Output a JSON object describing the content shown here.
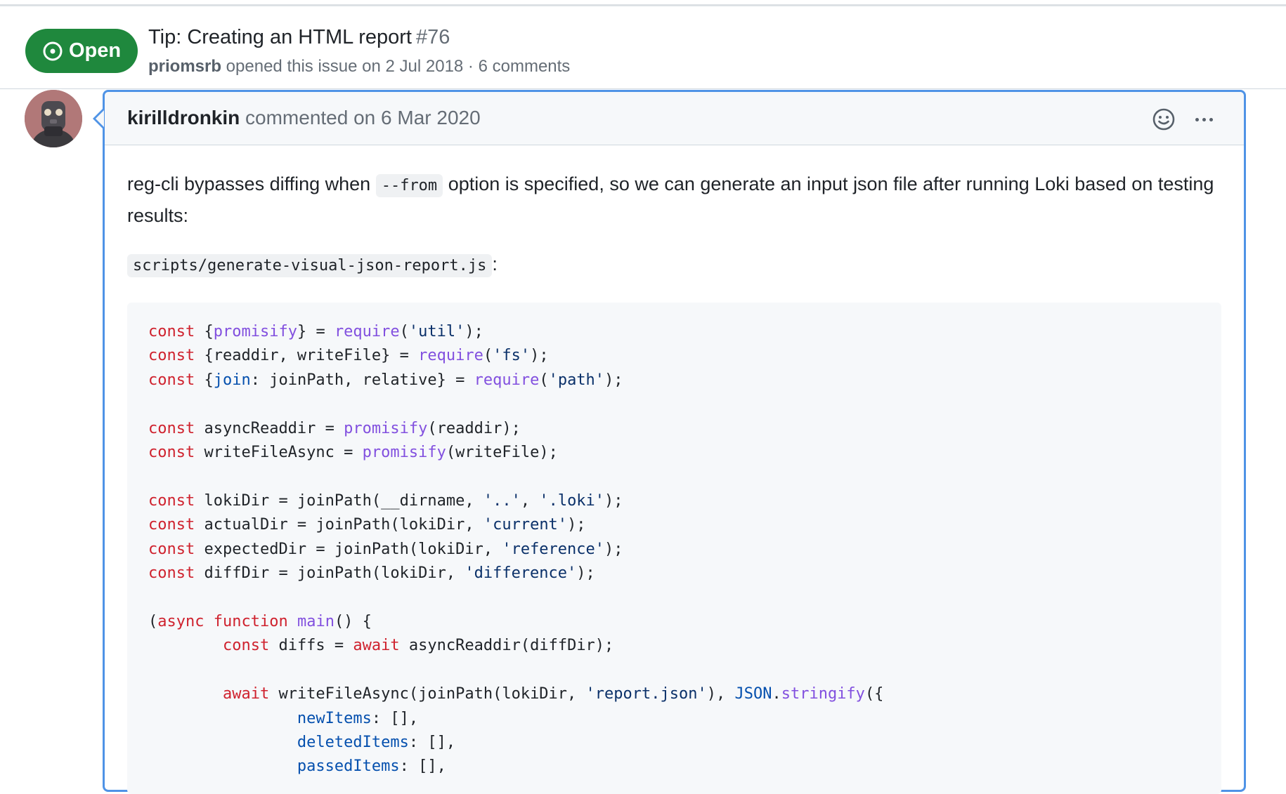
{
  "issue": {
    "state": "Open",
    "title": "Tip: Creating an HTML report",
    "number": "#76",
    "author": "priomsrb",
    "meta_text": " opened this issue on 2 Jul 2018 · 6 comments"
  },
  "comment": {
    "author": "kirilldronkin",
    "action": " commented on 6 Mar 2020",
    "body_before_code": "reg-cli bypasses diffing when ",
    "inline_code": "--from",
    "body_after_code": " option is specified, so we can generate an input json file after running Loki based on testing results:",
    "file_name": "scripts/generate-visual-json-report.js",
    "file_suffix": ":",
    "icons": {
      "reaction": "smiley-icon",
      "menu": "kebab-horizontal-icon"
    }
  },
  "code": {
    "language": "javascript",
    "lines": [
      "const {promisify} = require('util');",
      "const {readdir, writeFile} = require('fs');",
      "const {join: joinPath, relative} = require('path');",
      "",
      "const asyncReaddir = promisify(readdir);",
      "const writeFileAsync = promisify(writeFile);",
      "",
      "const lokiDir = joinPath(__dirname, '..', '.loki');",
      "const actualDir = joinPath(lokiDir, 'current');",
      "const expectedDir = joinPath(lokiDir, 'reference');",
      "const diffDir = joinPath(lokiDir, 'difference');",
      "",
      "(async function main() {",
      "        const diffs = await asyncReaddir(diffDir);",
      "",
      "        await writeFileAsync(joinPath(lokiDir, 'report.json'), JSON.stringify({",
      "                newItems: [],",
      "                deletedItems: [],",
      "                passedItems: [],"
    ]
  },
  "colors": {
    "open_badge": "#1f883d",
    "comment_border": "#4f93e6",
    "keyword": "#cf222e",
    "function": "#8250df",
    "constant": "#0550ae",
    "string": "#0a3069"
  }
}
